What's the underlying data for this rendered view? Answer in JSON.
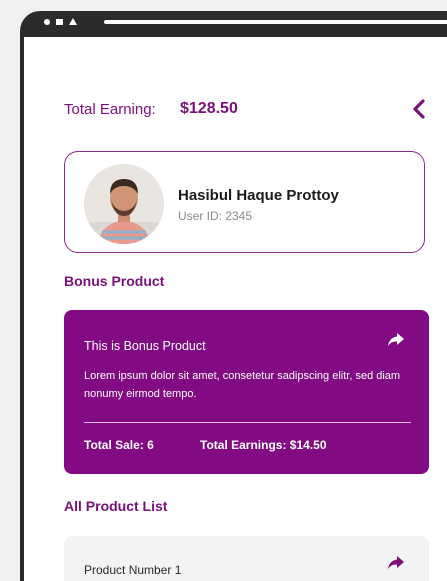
{
  "header": {
    "earning_label": "Total Earning:",
    "earning_value": "$128.50",
    "back_icon": "chevron-left-icon"
  },
  "profile": {
    "name": "Hasibul Haque Prottoy",
    "user_id": "User ID: 2345",
    "avatar": "avatar-photo"
  },
  "bonus_section": {
    "title": "Bonus Product",
    "card": {
      "title": "This is Bonus Product",
      "description": "Lorem ipsum dolor sit amet, consetetur sadipscing elitr, sed diam nonumy eirmod tempo.",
      "total_sale": "Total Sale: 6",
      "total_earnings": "Total Earnings: $14.50",
      "share_icon": "share-arrow-icon"
    }
  },
  "product_section": {
    "title": "All Product List",
    "items": [
      {
        "name": "Product Number 1",
        "share_icon": "share-arrow-icon"
      }
    ]
  },
  "colors": {
    "accent": "#820a82",
    "text_accent": "#7a1079",
    "background": "#f1f1f2",
    "frame": "#2b2b2b"
  }
}
